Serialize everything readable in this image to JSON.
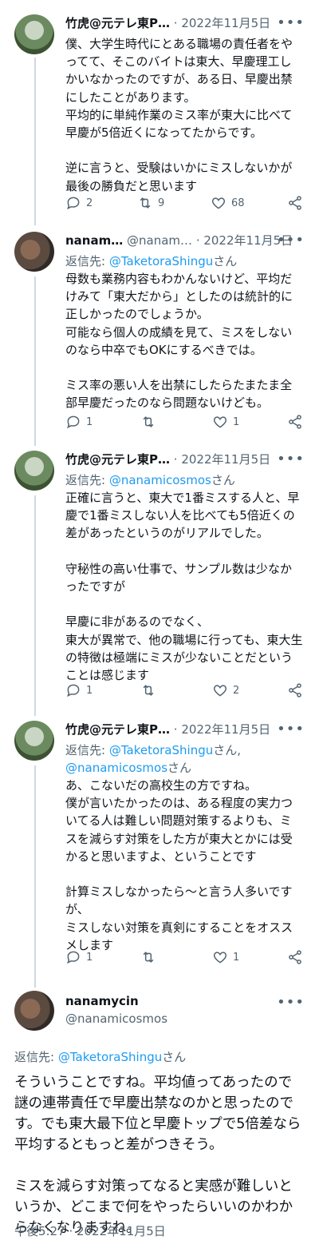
{
  "tweets": [
    {
      "name": "竹虎@元テレ東P…",
      "handle": "",
      "date": "· 2022年11月5日",
      "reply_prefix": "",
      "reply_links": [],
      "reply_suffix": "",
      "text": "僕、大学生時代にとある職場の責任者をやってて、そこのバイトは東大、早慶理工しかいなかったのですが、ある日、早慶出禁にしたことがあります。\n平均的に単純作業のミス率が東大に比べて早慶が5倍近くになってたからです。\n\n逆に言うと、受験はいかにミスしないかが最後の勝負だと思います",
      "replies": "2",
      "retweets": "9",
      "likes": "68"
    },
    {
      "name": "nanam…",
      "handle": "@nanam…",
      "date": "· 2022年11月5日",
      "reply_prefix": "返信先: ",
      "reply_links": [
        "@TaketoraShingu"
      ],
      "reply_suffix": "さん",
      "text": "母数も業務内容もわかんないけど、平均だけみて「東大だから」としたのは統計的に正しかったのでしょうか。\n可能なら個人の成績を見て、ミスをしないのなら中卒でもOKにするべきでは。\n\nミス率の悪い人を出禁にしたらたまたま全部早慶だったのなら問題ないけども。",
      "replies": "1",
      "retweets": "",
      "likes": "1"
    },
    {
      "name": "竹虎@元テレ東P…",
      "handle": "",
      "date": "· 2022年11月5日",
      "reply_prefix": "返信先: ",
      "reply_links": [
        "@nanamicosmos"
      ],
      "reply_suffix": "さん",
      "text": "正確に言うと、東大で1番ミスする人と、早慶で1番ミスしない人を比べても5倍近くの差があったというのがリアルでした。\n\n守秘性の高い仕事で、サンプル数は少なかったですが\n\n早慶に非があるのでなく、\n東大が異常で、他の職場に行っても、東大生の特徴は極端にミスが少ないことだということは感じます",
      "replies": "1",
      "retweets": "",
      "likes": "2"
    },
    {
      "name": "竹虎@元テレ東P…",
      "handle": "",
      "date": "· 2022年11月5日",
      "reply_prefix": "返信先: ",
      "reply_links": [
        "@TaketoraShingu",
        "@nanamicosmos"
      ],
      "reply_suffix": "さん",
      "text": "あ、こないだの高校生の方ですね。\n僕が言いたかったのは、ある程度の実力ついてる人は難しい問題対策するよりも、ミスを減らす対策をした方が東大とかには受かると思いますよ、ということです\n\n計算ミスしなかったら〜と言う人多いですが、\nミスしない対策を真剣にすることをオススメします",
      "replies": "1",
      "retweets": "",
      "likes": "1"
    }
  ],
  "focus": {
    "name": "nanamycin",
    "handle": "@nanamicosmos",
    "reply_prefix": "返信先: ",
    "reply_link": "@TaketoraShingu",
    "reply_suffix": "さん",
    "text": "そういうことですね。平均値ってあったので謎の連帯責任で早慶出禁なのかと思ったのです。でも東大最下位と早慶トップで5倍差なら平均するともっと差がつきそう。\n\nミスを減らす対策ってなると実感が難しいというか、どこまで何をやったらいいのかわからなくなりますね。",
    "timestamp": "午後5:27 · 2022年11月5日"
  },
  "colors": {
    "link": "#1d9bf0",
    "muted": "#536471",
    "text": "#0f1419"
  }
}
